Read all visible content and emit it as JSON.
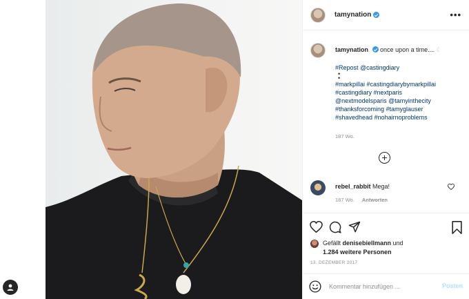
{
  "post": {
    "username": "tamynation",
    "caption_text": "once upon a time.... ",
    "tag_lines": [
      "#Repost @castingdiary",
      "#markpillai #castingdiarybymarkpillai",
      "#castingdiary #nextparis",
      "@nextmodelsparis @tamyinthecity",
      "#thanksforcoming #tamyglauser",
      "#shavedhead #nohairnoproblems"
    ],
    "dots": "•\n•",
    "caption_time": "187 Wo.",
    "comment": {
      "username": "rebel_rabbit",
      "text": "Mega!",
      "time": "187 Wo.",
      "reply": "Antworten"
    },
    "likes": {
      "prefix": "Gefällt ",
      "user": "denisebiellmann",
      "joiner": " und",
      "others": "1.284 weitere Personen"
    },
    "date": "13. DEZEMBER 2017",
    "comment_input": {
      "placeholder": "Kommentar hinzufügen ...",
      "post_label": "Posten"
    },
    "more_label": "•••"
  },
  "colors": {
    "link": "#00376b",
    "verified": "#3897f0",
    "muted": "#8e8e8e",
    "post_disabled": "#b2dffc"
  }
}
